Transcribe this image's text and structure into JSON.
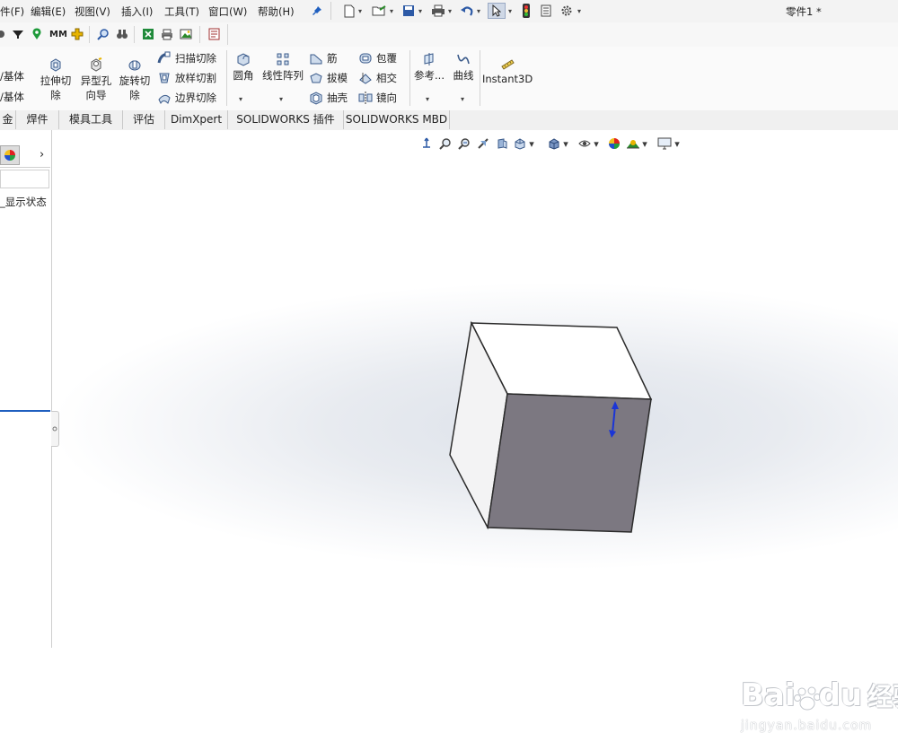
{
  "menu": {
    "items": [
      "件(F)",
      "编辑(E)",
      "视图(V)",
      "插入(I)",
      "工具(T)",
      "窗口(W)",
      "帮助(H)"
    ]
  },
  "document": {
    "title": "零件1 *"
  },
  "commands": {
    "partial_left_top": "/基体",
    "partial_left_bottom": "/基体",
    "extrude_cut": [
      "拉伸切",
      "除"
    ],
    "hole_wizard": [
      "异型孔",
      "向导"
    ],
    "revolve_cut": [
      "旋转切",
      "除"
    ],
    "swept_cut": "扫描切除",
    "lofted_cut": "放样切割",
    "boundary_cut": "边界切除",
    "fillet": "圆角",
    "linear_pattern": "线性阵列",
    "rib": "筋",
    "draft": "拔模",
    "shell": "抽壳",
    "wrap": "包覆",
    "intersect": "相交",
    "mirror": "镜向",
    "reference": "参考...",
    "curves": "曲线",
    "instant3d": "Instant3D"
  },
  "tabs": [
    "金",
    "焊件",
    "模具工具",
    "评估",
    "DimXpert",
    "SOLIDWORKS 插件",
    "SOLIDWORKS MBD"
  ],
  "tree": {
    "display_state": "_显示状态"
  },
  "watermark": {
    "brand": "Bai",
    "brand2": "du",
    "cn": "经验",
    "url": "jingyan.baidu.com"
  },
  "colors": {
    "accent": "#1f5fbf",
    "cube_dark_face": "#7c7881",
    "cube_light_face": "#ffffff",
    "triad": "#1a35d6"
  }
}
